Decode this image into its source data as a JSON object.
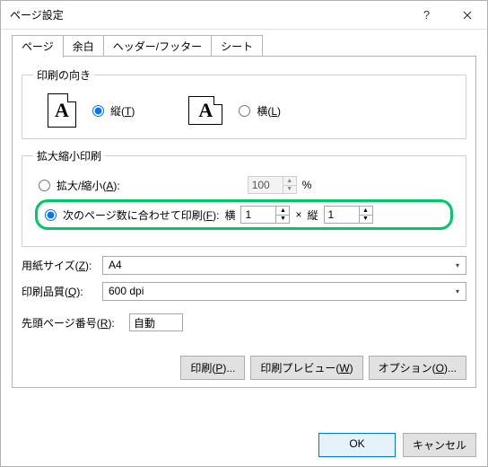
{
  "window": {
    "title": "ページ設定"
  },
  "tabs": {
    "page": "ページ",
    "margins": "余白",
    "headerfooter": "ヘッダー/フッター",
    "sheet": "シート"
  },
  "orientation": {
    "legend": "印刷の向き",
    "icon_glyph": "A",
    "portrait_label_pre": "縦(",
    "portrait_key": "T",
    "portrait_label_post": ")",
    "landscape_label_pre": "横(",
    "landscape_key": "L",
    "landscape_label_post": ")"
  },
  "scaling": {
    "legend": "拡大縮小印刷",
    "zoom_label_pre": "拡大/縮小(",
    "zoom_key": "A",
    "zoom_label_post": "):",
    "zoom_value": "100",
    "zoom_unit": "%",
    "fit_label_pre": "次のページ数に合わせて印刷(",
    "fit_key": "F",
    "fit_label_post": "):",
    "wide_label": "横",
    "wide_value": "1",
    "times": "×",
    "tall_label": "縦",
    "tall_value": "1"
  },
  "papersize": {
    "label_pre": "用紙サイズ(",
    "key": "Z",
    "label_post": "):",
    "value": "A4"
  },
  "printquality": {
    "label_pre": "印刷品質(",
    "key": "Q",
    "label_post": "):",
    "value": "600 dpi"
  },
  "firstpage": {
    "label_pre": "先頭ページ番号(",
    "key": "R",
    "label_post": "):",
    "value": "自動"
  },
  "panel_buttons": {
    "print_pre": "印刷(",
    "print_key": "P",
    "print_post": ")...",
    "preview_pre": "印刷プレビュー(",
    "preview_key": "W",
    "preview_post": ")",
    "options_pre": "オプション(",
    "options_key": "O",
    "options_post": ")..."
  },
  "dialog_buttons": {
    "ok": "OK",
    "cancel": "キャンセル"
  }
}
